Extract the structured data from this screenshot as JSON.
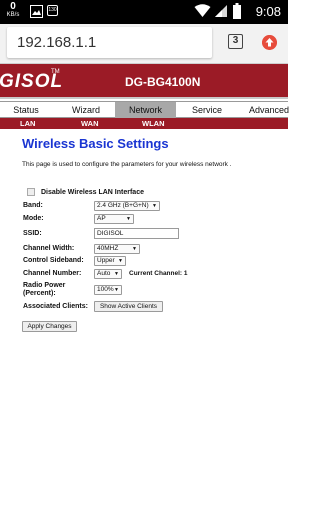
{
  "statusbar": {
    "speed_value": "0",
    "speed_unit": "KB/s",
    "notification_badge": "130",
    "time": "9:08"
  },
  "browser": {
    "url": "192.168.1.1",
    "tab_count": "3"
  },
  "router": {
    "brand": "GISOL",
    "brand_tm": "TM",
    "model": "DG-BG4100N"
  },
  "nav": {
    "items": [
      {
        "label": "Status"
      },
      {
        "label": "Wizard"
      },
      {
        "label": "Network"
      },
      {
        "label": "Service"
      },
      {
        "label": "Advanced"
      }
    ],
    "active": "Network",
    "sub_items": [
      {
        "label": "LAN"
      },
      {
        "label": "WAN"
      },
      {
        "label": "WLAN"
      }
    ]
  },
  "content": {
    "title": "Wireless Basic Settings",
    "description": "This page is used to configure the parameters for your wireless network .",
    "disable_label": "Disable Wireless LAN Interface",
    "disable_checked": false,
    "fields": {
      "band_label": "Band:",
      "band_value": "2.4 GHz (B+G+N)",
      "mode_label": "Mode:",
      "mode_value": "AP",
      "ssid_label": "SSID:",
      "ssid_value": "DIGISOL",
      "channel_width_label": "Channel Width:",
      "channel_width_value": "40MHZ",
      "control_sideband_label": "Control Sideband:",
      "control_sideband_value": "Upper",
      "channel_number_label": "Channel Number:",
      "channel_number_value": "Auto",
      "current_channel_label": "Current Channel: 1",
      "radio_power_label": "Radio Power",
      "radio_power_label2": "(Percent):",
      "radio_power_value": "100%",
      "associated_clients_label": "Associated Clients:",
      "show_clients_button": "Show Active Clients"
    },
    "apply_button": "Apply Changes"
  },
  "colors": {
    "banner": "#9b1b26",
    "title": "#1a35d2",
    "nav_active": "#a8a8a8"
  }
}
